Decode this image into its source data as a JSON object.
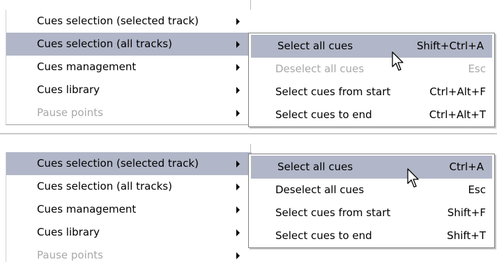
{
  "panels": [
    {
      "menu": {
        "items": [
          {
            "label": "Cues selection (selected track)",
            "state": "normal"
          },
          {
            "label": "Cues selection (all tracks)",
            "state": "selected"
          },
          {
            "label": "Cues management",
            "state": "normal"
          },
          {
            "label": "Cues library",
            "state": "normal"
          },
          {
            "label": "Pause points",
            "state": "disabled"
          }
        ]
      },
      "submenu": {
        "items": [
          {
            "label": "Select all cues",
            "shortcut": "Shift+Ctrl+A",
            "state": "selected"
          },
          {
            "label": "Deselect all cues",
            "shortcut": "Esc",
            "state": "disabled"
          },
          {
            "label": "Select cues from start",
            "shortcut": "Ctrl+Alt+F",
            "state": "normal"
          },
          {
            "label": "Select cues to end",
            "shortcut": "Ctrl+Alt+T",
            "state": "normal"
          }
        ]
      }
    },
    {
      "menu": {
        "items": [
          {
            "label": "Cues selection (selected track)",
            "state": "selected"
          },
          {
            "label": "Cues selection (all tracks)",
            "state": "normal"
          },
          {
            "label": "Cues management",
            "state": "normal"
          },
          {
            "label": "Cues library",
            "state": "normal"
          },
          {
            "label": "Pause points",
            "state": "disabled"
          }
        ]
      },
      "submenu": {
        "items": [
          {
            "label": "Select all cues",
            "shortcut": "Ctrl+A",
            "state": "selected"
          },
          {
            "label": "Deselect all cues",
            "shortcut": "Esc",
            "state": "normal"
          },
          {
            "label": "Select cues from start",
            "shortcut": "Shift+F",
            "state": "normal"
          },
          {
            "label": "Select cues to end",
            "shortcut": "Shift+T",
            "state": "normal"
          }
        ]
      }
    }
  ],
  "colors": {
    "highlight": "#b1b6c8",
    "disabled_text": "#a8a8a8"
  },
  "icons": {
    "cursor": "arrow-pointer-icon",
    "submenu": "submenu-arrow-icon"
  }
}
